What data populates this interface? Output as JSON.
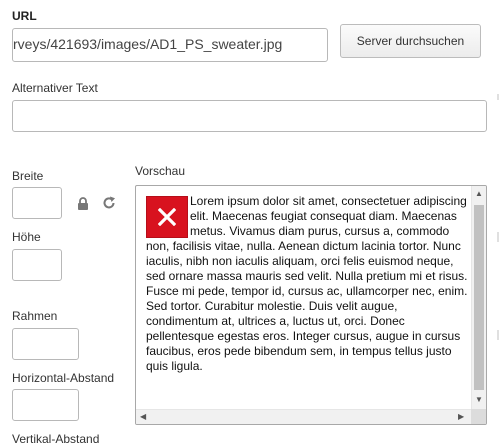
{
  "url_field": {
    "label": "URL",
    "value": "rveys/421693/images/AD1_PS_sweater.jpg"
  },
  "browse_button": {
    "label": "Server durchsuchen"
  },
  "alt_text": {
    "label": "Alternativer Text",
    "value": ""
  },
  "width": {
    "label": "Breite",
    "value": ""
  },
  "height": {
    "label": "Höhe",
    "value": ""
  },
  "border": {
    "label": "Rahmen",
    "value": ""
  },
  "hspace": {
    "label": "Horizontal-Abstand",
    "value": ""
  },
  "vspace": {
    "label": "Vertikal-Abstand"
  },
  "icons": {
    "lock": "lock-icon",
    "reset": "reset-size-icon"
  },
  "preview": {
    "label": "Vorschau",
    "text": "Lorem ipsum dolor sit amet, consectetuer adipiscing elit. Maecenas feugiat consequat diam. Maecenas metus. Vivamus diam purus, cursus a, commodo non, facilisis vitae, nulla. Aenean dictum lacinia tortor. Nunc iaculis, nibh non iaculis aliquam, orci felis euismod neque, sed ornare massa mauris sed velit. Nulla pretium mi et risus. Fusce mi pede, tempor id, cursus ac, ullamcorper nec, enim. Sed tortor. Curabitur molestie. Duis velit augue, condimentum at, ultrices a, luctus ut, orci. Donec pellentesque egestas eros. Integer cursus, augue in cursus faucibus, eros pede bibendum sem, in tempus tellus justo quis ligula."
  },
  "colors": {
    "broken_image_red": "#d8121f"
  }
}
